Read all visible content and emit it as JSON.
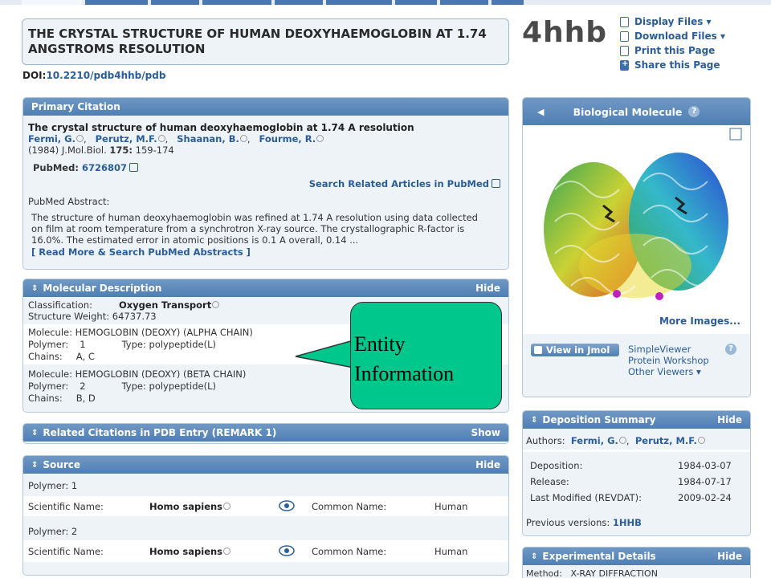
{
  "header": {
    "title": "THE CRYSTAL STRUCTURE OF HUMAN DEOXYHAEMOGLOBIN AT 1.74 ANGSTROMS RESOLUTION",
    "doi_label": "DOI:",
    "doi_value": "10.2210/pdb4hhb/pdb",
    "pdb_id": "4hhb",
    "actions": [
      "Display Files ▾",
      "Download Files ▾",
      "Print this Page",
      "Share this Page"
    ]
  },
  "primary_citation": {
    "heading": "Primary Citation",
    "title": "The crystal structure of human deoxyhaemoglobin at 1.74 A resolution",
    "authors": [
      "Fermi, G.",
      "Perutz, M.F.",
      "Shaanan, B.",
      "Fourme, R."
    ],
    "journal_prefix": "(1984) J.Mol.Biol.",
    "volume": "175:",
    "pages": "159-174",
    "pubmed_label": "PubMed:",
    "pubmed_id": "6726807",
    "search_related": "Search Related Articles in PubMed",
    "abstract_label": "PubMed Abstract:",
    "abstract_lines": [
      "The structure of human deoxyhaemoglobin was refined at 1.74 A resolution using data collected",
      "on film at room temperature from a synchrotron X-ray source. The crystallographic R-factor is",
      "16.0%. The estimated error in atomic positions is 0.1 A overall, 0.14 ..."
    ],
    "read_more": "[ Read More & Search PubMed Abstracts ]"
  },
  "molecular_description": {
    "heading": "Molecular Description",
    "hide": "Hide",
    "classification_label": "Classification:",
    "classification": "Oxygen Transport",
    "weight_label": "Structure Weight:",
    "weight": "64737.73",
    "entities": [
      {
        "molecule_label": "Molecule:",
        "molecule": "HEMOGLOBIN (DEOXY) (ALPHA CHAIN)",
        "polymer_label": "Polymer:",
        "polymer": "1",
        "type_label": "Type:",
        "type": "polypeptide(L)",
        "chains_label": "Chains:",
        "chains": "A, C"
      },
      {
        "molecule_label": "Molecule:",
        "molecule": "HEMOGLOBIN (DEOXY) (BETA CHAIN)",
        "polymer_label": "Polymer:",
        "polymer": "2",
        "type_label": "Type:",
        "type": "polypeptide(L)",
        "chains_label": "Chains:",
        "chains": "B, D"
      }
    ]
  },
  "callout": {
    "line1": "Entity",
    "line2": "Information"
  },
  "related_citations": {
    "heading": "Related Citations in PDB Entry (REMARK 1)",
    "show": "Show"
  },
  "source": {
    "heading": "Source",
    "hide": "Hide",
    "rows": [
      {
        "polymer_label": "Polymer:",
        "polymer": "1",
        "sci_label": "Scientific Name:",
        "sci": "Homo sapiens",
        "common_label": "Common Name:",
        "common": "Human"
      },
      {
        "polymer_label": "Polymer:",
        "polymer": "2",
        "sci_label": "Scientific Name:",
        "sci": "Homo sapiens",
        "common_label": "Common Name:",
        "common": "Human"
      }
    ]
  },
  "biological_molecule": {
    "heading": "Biological Molecule",
    "help": "?",
    "more_images": "More Images...",
    "view_jmol": "View in Jmol",
    "viewers": [
      "SimpleViewer",
      "Protein Workshop",
      "Other Viewers ▾"
    ]
  },
  "deposition_summary": {
    "heading": "Deposition Summary",
    "hide": "Hide",
    "authors_label": "Authors:",
    "authors": [
      "Fermi, G.",
      "Perutz, M.F."
    ],
    "rows": [
      {
        "label": "Deposition:",
        "value": "1984-03-07"
      },
      {
        "label": "Release:",
        "value": "1984-07-17"
      },
      {
        "label": "Last Modified (REVDAT):",
        "value": "2009-02-24"
      }
    ],
    "previous_label": "Previous versions:",
    "previous_value": "1HHB"
  },
  "experimental_details": {
    "heading": "Experimental Details",
    "hide": "Hide",
    "method_label": "Method:",
    "method": "X-RAY DIFFRACTION"
  },
  "colors": {
    "accent": "#4f7fb3",
    "link": "#2a5d9a",
    "panel_bg": "#eef3f8",
    "callout": "#00c78c"
  }
}
